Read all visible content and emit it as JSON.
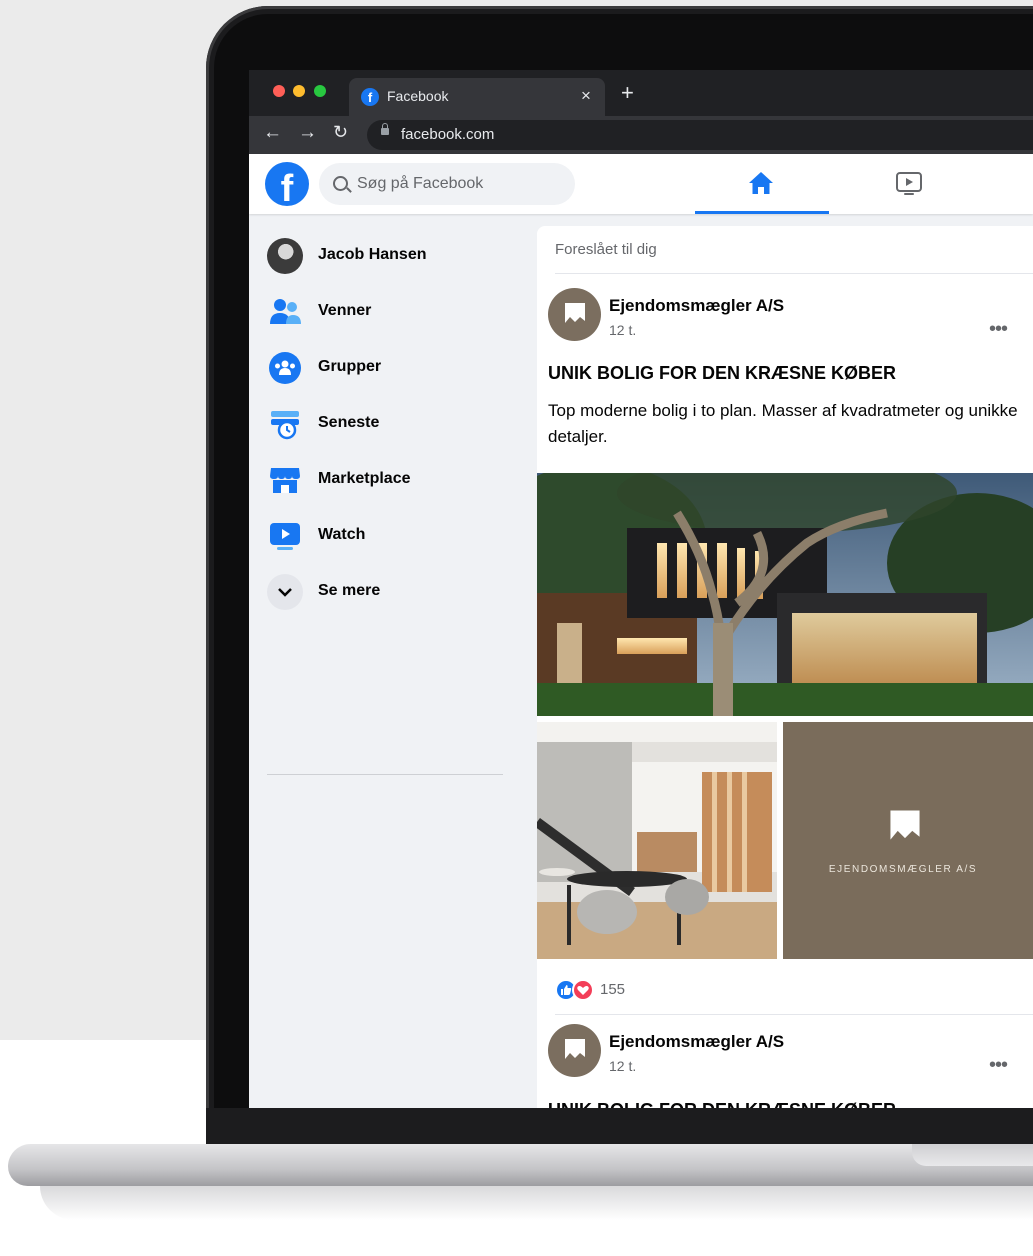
{
  "browser": {
    "tab_title": "Facebook",
    "tab_close": "×",
    "new_tab": "+",
    "url": "facebook.com",
    "favicon_letter": "f"
  },
  "header": {
    "logo_letter": "f",
    "search_placeholder": "Søg på Facebook",
    "accent_color": "#1877f2"
  },
  "sidebar": {
    "items": [
      {
        "label": "Jacob Hansen",
        "icon": "profile-avatar"
      },
      {
        "label": "Venner",
        "icon": "friends-icon"
      },
      {
        "label": "Grupper",
        "icon": "groups-icon"
      },
      {
        "label": "Seneste",
        "icon": "recent-icon"
      },
      {
        "label": "Marketplace",
        "icon": "marketplace-icon"
      },
      {
        "label": "Watch",
        "icon": "watch-icon"
      },
      {
        "label": "Se mere",
        "icon": "chevron-down-icon"
      }
    ]
  },
  "feed": {
    "suggested_label": "Foreslået til dig",
    "post": {
      "author": "Ejendomsmægler A/S",
      "time": "12 t.",
      "more": "•••",
      "headline": "UNIK BOLIG FOR DEN KRÆSNE KØBER",
      "body": "Top moderne bolig i to plan. Masser af kvadratmeter og unikke detaljer.",
      "brand_tile_text": "EJENDOMSMÆGLER A/S",
      "reaction_count": "155"
    },
    "next_post": {
      "author": "Ejendomsmægler A/S",
      "time": "12 t.",
      "more": "•••",
      "headline": "UNIK BOLIG FOR DEN KRÆSNE KØBER"
    }
  }
}
